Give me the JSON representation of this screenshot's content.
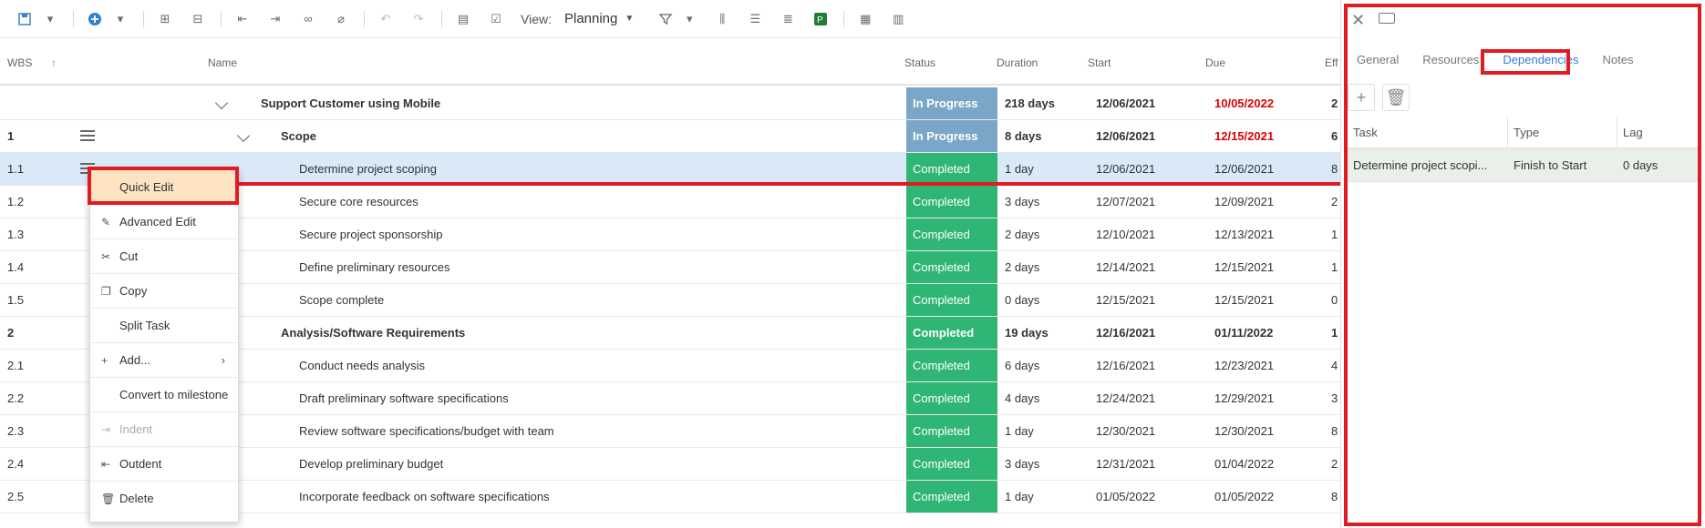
{
  "toolbar": {
    "view_label": "View:",
    "view_value": "Planning"
  },
  "grid": {
    "columns": {
      "wbs": "WBS",
      "name": "Name",
      "status": "Status",
      "duration": "Duration",
      "start": "Start",
      "due": "Due",
      "effort": "Eff"
    },
    "rows": [
      {
        "wbs": "",
        "name": "Support Customer using Mobile",
        "status": "In Progress",
        "duration": "218 days",
        "start": "12/06/2021",
        "due": "10/05/2022",
        "effort": "2"
      },
      {
        "wbs": "1",
        "name": "Scope",
        "status": "In Progress",
        "duration": "8 days",
        "start": "12/06/2021",
        "due": "12/15/2021",
        "effort": "6"
      },
      {
        "wbs": "1.1",
        "name": "Determine project scoping",
        "status": "Completed",
        "duration": "1 day",
        "start": "12/06/2021",
        "due": "12/06/2021",
        "effort": "8"
      },
      {
        "wbs": "1.2",
        "name": "Secure core resources",
        "status": "Completed",
        "duration": "3 days",
        "start": "12/07/2021",
        "due": "12/09/2021",
        "effort": "2"
      },
      {
        "wbs": "1.3",
        "name": "Secure project sponsorship",
        "status": "Completed",
        "duration": "2 days",
        "start": "12/10/2021",
        "due": "12/13/2021",
        "effort": "1"
      },
      {
        "wbs": "1.4",
        "name": "Define preliminary resources",
        "status": "Completed",
        "duration": "2 days",
        "start": "12/14/2021",
        "due": "12/15/2021",
        "effort": "1"
      },
      {
        "wbs": "1.5",
        "name": "Scope complete",
        "status": "Completed",
        "duration": "0 days",
        "start": "12/15/2021",
        "due": "12/15/2021",
        "effort": "0"
      },
      {
        "wbs": "2",
        "name": "Analysis/Software Requirements",
        "status": "Completed",
        "duration": "19 days",
        "start": "12/16/2021",
        "due": "01/11/2022",
        "effort": "1"
      },
      {
        "wbs": "2.1",
        "name": "Conduct needs analysis",
        "status": "Completed",
        "duration": "6 days",
        "start": "12/16/2021",
        "due": "12/23/2021",
        "effort": "4"
      },
      {
        "wbs": "2.2",
        "name": "Draft preliminary software specifications",
        "status": "Completed",
        "duration": "4 days",
        "start": "12/24/2021",
        "due": "12/29/2021",
        "effort": "3"
      },
      {
        "wbs": "2.3",
        "name": "Review software specifications/budget with team",
        "status": "Completed",
        "duration": "1 day",
        "start": "12/30/2021",
        "due": "12/30/2021",
        "effort": "8"
      },
      {
        "wbs": "2.4",
        "name": "Develop preliminary budget",
        "status": "Completed",
        "duration": "3 days",
        "start": "12/31/2021",
        "due": "01/04/2022",
        "effort": "2"
      },
      {
        "wbs": "2.5",
        "name": "Incorporate feedback on software specifications",
        "status": "Completed",
        "duration": "1 day",
        "start": "01/05/2022",
        "due": "01/05/2022",
        "effort": "8"
      }
    ]
  },
  "context_menu": {
    "items": [
      {
        "label": "Quick Edit"
      },
      {
        "label": "Advanced Edit"
      },
      {
        "label": "Cut"
      },
      {
        "label": "Copy"
      },
      {
        "label": "Split Task"
      },
      {
        "label": "Add..."
      },
      {
        "label": "Convert to milestone"
      },
      {
        "label": "Indent"
      },
      {
        "label": "Outdent"
      },
      {
        "label": "Delete"
      }
    ]
  },
  "panel": {
    "tabs": [
      "General",
      "Resources",
      "Dependencies",
      "Notes"
    ],
    "active_tab": "Dependencies",
    "columns": {
      "task": "Task",
      "type": "Type",
      "lag": "Lag"
    },
    "rows": [
      {
        "task": "Determine project scopi...",
        "type": "Finish to Start",
        "lag": "0 days"
      }
    ]
  },
  "colors": {
    "in_progress": "#7aa7c7",
    "completed": "#2fb574",
    "overdue_red": "#e00000",
    "highlight_red": "#e01b24",
    "selected_row": "#d9e9f7",
    "menu_active": "#fde3c2",
    "tab_active": "#2f7fd6"
  }
}
